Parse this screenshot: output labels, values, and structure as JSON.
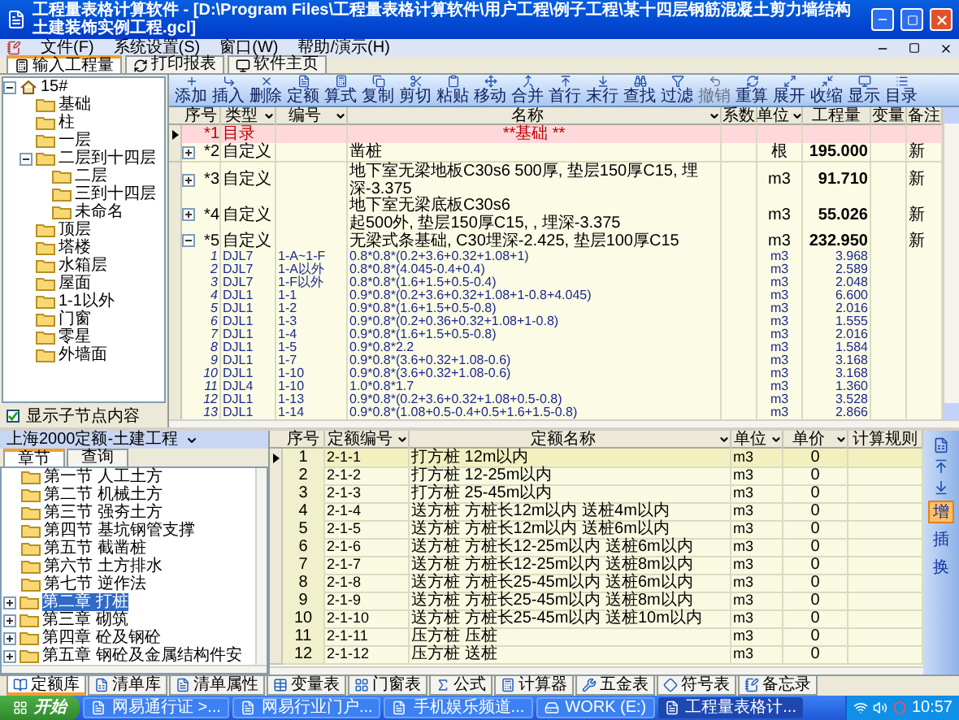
{
  "window": {
    "title": "工程量表格计算软件 - [D:\\Program Files\\工程量表格计算软件\\用户工程\\例子工程\\某十四层钢筋混凝土剪力墙结构土建装饰实例工程.gcl]"
  },
  "menu": [
    "文件(F)",
    "系统设置(S)",
    "窗口(W)",
    "帮助/演示(H)"
  ],
  "tabs": [
    {
      "label": "输入工程量",
      "selected": true
    },
    {
      "label": "打印报表",
      "selected": false
    },
    {
      "label": "软件主页",
      "selected": false
    }
  ],
  "project_tree": {
    "label": "15#",
    "expanded": true,
    "children": [
      {
        "label": "基础"
      },
      {
        "label": "柱"
      },
      {
        "label": "一层"
      },
      {
        "label": "二层到十四层",
        "expanded": true,
        "children": [
          {
            "label": "二层"
          },
          {
            "label": "三到十四层"
          },
          {
            "label": "未命名"
          }
        ]
      },
      {
        "label": "顶层"
      },
      {
        "label": "塔楼"
      },
      {
        "label": "水箱层"
      },
      {
        "label": "屋面"
      },
      {
        "label": "1-1以外"
      },
      {
        "label": "门窗"
      },
      {
        "label": "零星"
      },
      {
        "label": "外墙面"
      }
    ]
  },
  "show_children_checkbox": {
    "label": "显示子节点内容",
    "checked": true
  },
  "toolbar": [
    {
      "label": "添加",
      "disabled": false
    },
    {
      "label": "插入",
      "disabled": false
    },
    {
      "label": "删除",
      "disabled": false
    },
    {
      "label": "定额",
      "disabled": false
    },
    {
      "label": "算式",
      "disabled": false
    },
    {
      "label": "复制",
      "disabled": false
    },
    {
      "label": "剪切",
      "disabled": false
    },
    {
      "label": "粘贴",
      "disabled": false
    },
    {
      "label": "移动",
      "disabled": false
    },
    {
      "label": "合并",
      "disabled": false
    },
    {
      "label": "首行",
      "disabled": false
    },
    {
      "label": "末行",
      "disabled": false
    },
    {
      "label": "查找",
      "disabled": false
    },
    {
      "label": "过滤",
      "disabled": false
    },
    {
      "label": "撤销",
      "disabled": true
    },
    {
      "label": "重算",
      "disabled": false
    },
    {
      "label": "展开",
      "disabled": false
    },
    {
      "label": "收缩",
      "disabled": false
    },
    {
      "label": "显示",
      "disabled": false
    },
    {
      "label": "目录",
      "disabled": false
    }
  ],
  "quantity_table": {
    "columns": [
      {
        "label": "序号",
        "filter": false
      },
      {
        "label": "类型",
        "filter": true
      },
      {
        "label": "编号",
        "filter": true
      },
      {
        "label": "名称",
        "filter": true
      },
      {
        "label": "系数",
        "filter": false
      },
      {
        "label": "单位",
        "filter": true
      },
      {
        "label": "工程量",
        "filter": false
      },
      {
        "label": "变量",
        "filter": false
      },
      {
        "label": "备注",
        "filter": false
      }
    ],
    "rows": [
      {
        "kind": "heading",
        "no": "*1",
        "type": "目录",
        "name": "**基础 **",
        "selected": true
      },
      {
        "kind": "item",
        "no": "*2",
        "type": "自定义",
        "name": "凿桩",
        "unit": "根",
        "quantity": "195.000",
        "note": "新",
        "expanded": false,
        "selected": false
      },
      {
        "kind": "item",
        "no": "*3",
        "type": "自定义",
        "name": "地下室无梁地板C30s6 500厚, 垫层150厚C15, 埋深-3.375",
        "unit": "m3",
        "quantity": "91.710",
        "note": "新",
        "expanded": false,
        "selected": false
      },
      {
        "kind": "item",
        "no": "*4",
        "type": "自定义",
        "name": "地下室无梁底板C30s6\n起500外, 垫层150厚C15, , 埋深-3.375",
        "unit": "m3",
        "quantity": "55.026",
        "note": "新",
        "expanded": false,
        "selected": false
      },
      {
        "kind": "item",
        "no": "*5",
        "type": "自定义",
        "name": "无梁式条基础, C30埋深-2.425, 垫层100厚C15",
        "unit": "m3",
        "quantity": "232.950",
        "note": "新",
        "expanded": true,
        "selected": false,
        "children": [
          {
            "no": "1",
            "type": "DJL7",
            "code": "1-A~1-F",
            "formula": "0.8*0.8*(0.2+3.6+0.32+1.08+1)",
            "unit": "m3",
            "quantity": "3.968"
          },
          {
            "no": "2",
            "type": "DJL7",
            "code": "1-A以外",
            "formula": "0.8*0.8*(4.045-0.4+0.4)",
            "unit": "m3",
            "quantity": "2.589"
          },
          {
            "no": "3",
            "type": "DJL7",
            "code": "1-F以外",
            "formula": "0.8*0.8*(1.6+1.5+0.5-0.4)",
            "unit": "m3",
            "quantity": "2.048"
          },
          {
            "no": "4",
            "type": "DJL1",
            "code": "1-1",
            "formula": "0.9*0.8*(0.2+3.6+0.32+1.08+1-0.8+4.045)",
            "unit": "m3",
            "quantity": "6.600"
          },
          {
            "no": "5",
            "type": "DJL1",
            "code": "1-2",
            "formula": "0.9*0.8*(1.6+1.5+0.5-0.8)",
            "unit": "m3",
            "quantity": "2.016"
          },
          {
            "no": "6",
            "type": "DJL1",
            "code": "1-3",
            "formula": "0.9*0.8*(0.2+0.36+0.32+1.08+1-0.8)",
            "unit": "m3",
            "quantity": "1.555"
          },
          {
            "no": "7",
            "type": "DJL1",
            "code": "1-4",
            "formula": "0.9*0.8*(1.6+1.5+0.5-0.8)",
            "unit": "m3",
            "quantity": "2.016"
          },
          {
            "no": "8",
            "type": "DJL1",
            "code": "1-5",
            "formula": "0.9*0.8*2.2",
            "unit": "m3",
            "quantity": "1.584"
          },
          {
            "no": "9",
            "type": "DJL1",
            "code": "1-7",
            "formula": "0.9*0.8*(3.6+0.32+1.08-0.6)",
            "unit": "m3",
            "quantity": "3.168"
          },
          {
            "no": "10",
            "type": "DJL1",
            "code": "1-10",
            "formula": "0.9*0.8*(3.6+0.32+1.08-0.6)",
            "unit": "m3",
            "quantity": "3.168"
          },
          {
            "no": "11",
            "type": "DJL4",
            "code": "1-10",
            "formula": "1.0*0.8*1.7",
            "unit": "m3",
            "quantity": "1.360"
          },
          {
            "no": "12",
            "type": "DJL1",
            "code": "1-13",
            "formula": "0.9*0.8*(0.2+3.6+0.32+1.08+0.5-0.8)",
            "unit": "m3",
            "quantity": "3.528"
          },
          {
            "no": "13",
            "type": "DJL1",
            "code": "1-14",
            "formula": "0.9*0.8*(1.08+0.5-0.4+0.5+1.6+1.5-0.8)",
            "unit": "m3",
            "quantity": "2.866"
          }
        ]
      }
    ]
  },
  "quota_library": {
    "dropdown": "上海2000定额-土建工程",
    "tabs": [
      {
        "label": "章节",
        "selected": true
      },
      {
        "label": "查询",
        "selected": false
      }
    ],
    "items": [
      {
        "kind": "section",
        "label": "第一节 人工土方",
        "selected": false
      },
      {
        "kind": "section",
        "label": "第二节 机械土方",
        "selected": false
      },
      {
        "kind": "section",
        "label": "第三节 强夯土方",
        "selected": false
      },
      {
        "kind": "section",
        "label": "第四节 基坑钢管支撑",
        "selected": false
      },
      {
        "kind": "section",
        "label": "第五节 截凿桩",
        "selected": false
      },
      {
        "kind": "section",
        "label": "第六节 土方排水",
        "selected": false
      },
      {
        "kind": "section",
        "label": "第七节 逆作法",
        "selected": false
      },
      {
        "kind": "chapter",
        "label": "第二章 打桩",
        "selected": true
      },
      {
        "kind": "chapter",
        "label": "第三章 砌筑",
        "selected": false
      },
      {
        "kind": "chapter",
        "label": "第四章 砼及钢砼",
        "selected": false
      },
      {
        "kind": "chapter",
        "label": "第五章 钢砼及金属结构件安",
        "selected": false
      }
    ]
  },
  "quota_table": {
    "columns": [
      {
        "label": "序号",
        "filter": false
      },
      {
        "label": "定额编号",
        "filter": true
      },
      {
        "label": "定额名称",
        "filter": true
      },
      {
        "label": "单位",
        "filter": true
      },
      {
        "label": "单价",
        "filter": true
      },
      {
        "label": "计算规则",
        "filter": false
      }
    ],
    "rows": [
      {
        "no": "1",
        "code": "2-1-1",
        "name": "打方桩 12m以内",
        "unit": "m3",
        "price": "0",
        "selected": true
      },
      {
        "no": "2",
        "code": "2-1-2",
        "name": "打方桩 12-25m以内",
        "unit": "m3",
        "price": "0",
        "selected": false
      },
      {
        "no": "3",
        "code": "2-1-3",
        "name": "打方桩 25-45m以内",
        "unit": "m3",
        "price": "0",
        "selected": false
      },
      {
        "no": "4",
        "code": "2-1-4",
        "name": "送方桩 方桩长12m以内 送桩4m以内",
        "unit": "m3",
        "price": "0",
        "selected": false
      },
      {
        "no": "5",
        "code": "2-1-5",
        "name": "送方桩 方桩长12m以内 送桩6m以内",
        "unit": "m3",
        "price": "0",
        "selected": false
      },
      {
        "no": "6",
        "code": "2-1-6",
        "name": "送方桩 方桩长12-25m以内 送桩6m以内",
        "unit": "m3",
        "price": "0",
        "selected": false
      },
      {
        "no": "7",
        "code": "2-1-7",
        "name": "送方桩 方桩长12-25m以内 送桩8m以内",
        "unit": "m3",
        "price": "0",
        "selected": false
      },
      {
        "no": "8",
        "code": "2-1-8",
        "name": "送方桩 方桩长25-45m以内 送桩6m以内",
        "unit": "m3",
        "price": "0",
        "selected": false
      },
      {
        "no": "9",
        "code": "2-1-9",
        "name": "送方桩 方桩长25-45m以内 送桩8m以内",
        "unit": "m3",
        "price": "0",
        "selected": false
      },
      {
        "no": "10",
        "code": "2-1-10",
        "name": "送方桩 方桩长25-45m以内 送桩10m以内",
        "unit": "m3",
        "price": "0",
        "selected": false
      },
      {
        "no": "11",
        "code": "2-1-11",
        "name": "压方桩 压桩",
        "unit": "m3",
        "price": "0",
        "selected": false
      },
      {
        "no": "12",
        "code": "2-1-12",
        "name": "压方桩 送桩",
        "unit": "m3",
        "price": "0",
        "selected": false
      }
    ]
  },
  "side_bar": [
    {
      "label": "增",
      "selected": true
    },
    {
      "label": "插",
      "selected": false
    },
    {
      "label": "换",
      "selected": false
    }
  ],
  "bottom_tabs": [
    {
      "label": "定额库",
      "selected": true
    },
    {
      "label": "清单库",
      "selected": false
    },
    {
      "label": "清单属性",
      "selected": false
    },
    {
      "label": "变量表",
      "selected": false
    },
    {
      "label": "门窗表",
      "selected": false
    },
    {
      "label": "公式",
      "selected": false
    },
    {
      "label": "计算器",
      "selected": false
    },
    {
      "label": "五金表",
      "selected": false
    },
    {
      "label": "符号表",
      "selected": false
    },
    {
      "label": "备忘录",
      "selected": false
    }
  ],
  "taskbar": {
    "start": "开始",
    "tasks": [
      {
        "label": "网易通行证 >...",
        "active": false
      },
      {
        "label": "网易行业门户...",
        "active": false
      },
      {
        "label": "手机娱乐频道...",
        "active": false
      },
      {
        "label": "WORK (E:)",
        "active": false
      },
      {
        "label": "工程量表格计...",
        "active": true
      }
    ],
    "clock": "10:57"
  }
}
